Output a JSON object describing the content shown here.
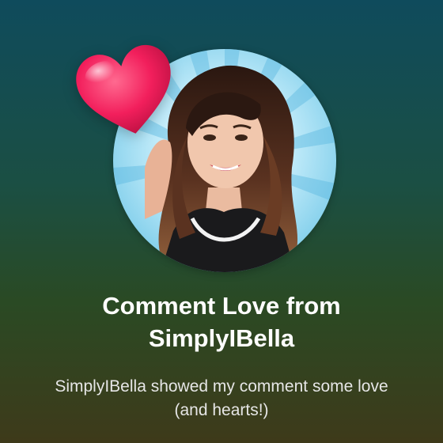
{
  "notification": {
    "title": "Comment Love from SimplyIBella",
    "message": "SimplyIBella showed my comment some love (and hearts!)",
    "avatar_icon": "profile-photo",
    "badge_icon": "heart-icon"
  },
  "colors": {
    "heart": "#f21f5c",
    "avatar_background": "#8fd6ee",
    "text_primary": "#ffffff",
    "text_secondary": "#e6e6e6"
  }
}
